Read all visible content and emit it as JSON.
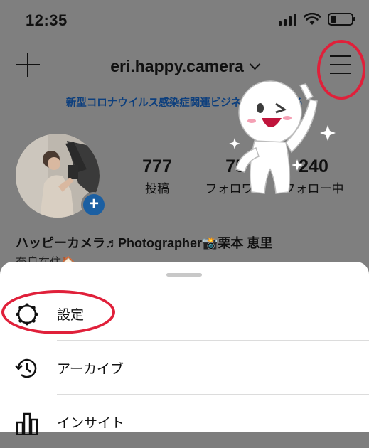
{
  "status_bar": {
    "time": "12:35"
  },
  "header": {
    "username": "eri.happy.camera"
  },
  "notice": {
    "text": "新型コロナウイルス感染症関連ビジネス支援を見る"
  },
  "profile": {
    "stats": [
      {
        "value": "777",
        "label": "投稿"
      },
      {
        "value": "75",
        "label": "フォロワー"
      },
      {
        "value": "240",
        "label": "フォロー中"
      }
    ],
    "bio_name": "ハッピーカメラ♬Photographer📸栗本 恵里",
    "bio_line": "奈良在住🏠"
  },
  "menu_sheet": {
    "items": [
      {
        "label": "設定",
        "icon": "gear-icon"
      },
      {
        "label": "アーカイブ",
        "icon": "archive-clock-icon"
      },
      {
        "label": "インサイト",
        "icon": "insights-bar-icon"
      }
    ]
  },
  "colors": {
    "highlight": "#e0203a",
    "link": "#0d3f7d",
    "avatar_badge": "#1b5fa2"
  }
}
